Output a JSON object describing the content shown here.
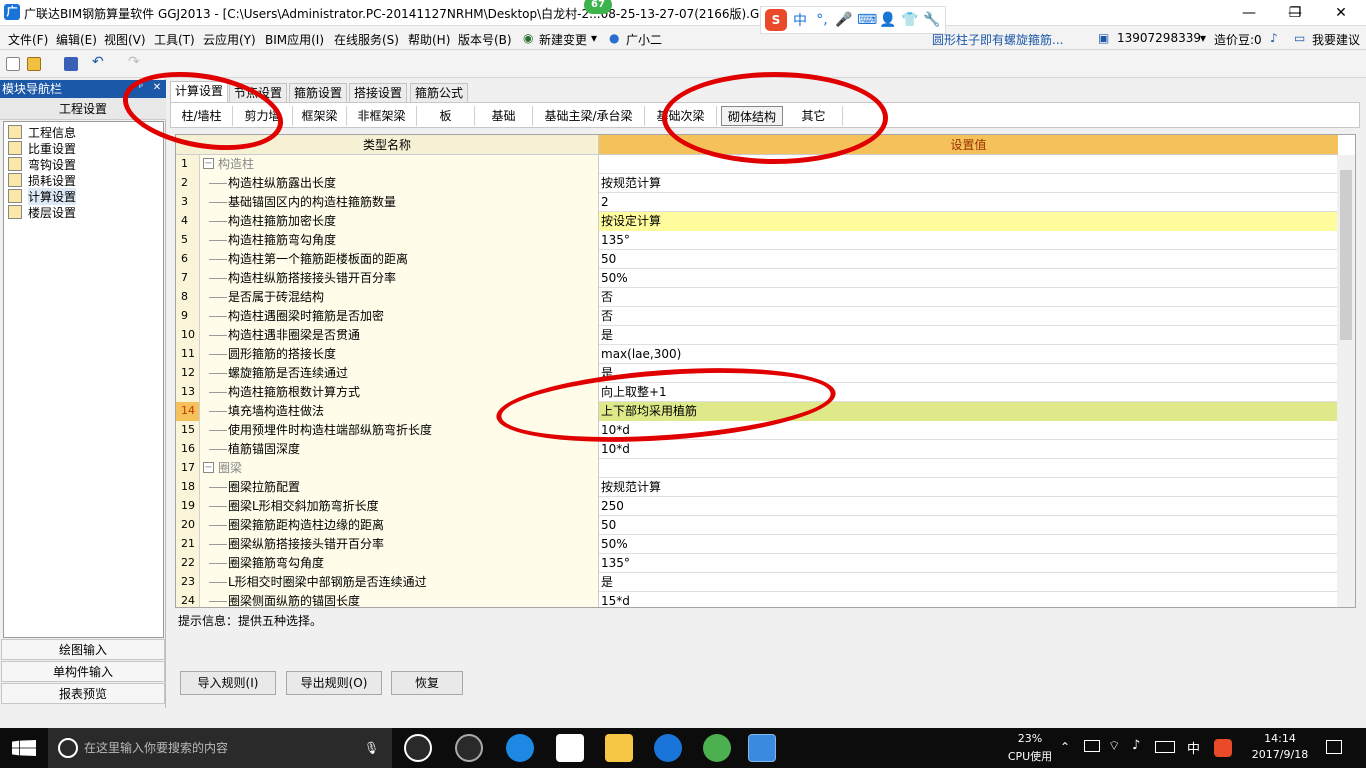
{
  "window": {
    "title": "广联达BIM钢筋算量软件 GGJ2013 - [C:\\Users\\Administrator.PC-20141127NRHM\\Desktop\\白龙村-2...08-25-13-27-07(2166版).GG...]",
    "badge": "67",
    "minimize": "—",
    "restore": "❐",
    "close": "✕"
  },
  "ime": {
    "logo": "S",
    "items": [
      "中",
      "°,",
      "🎤",
      "⌨",
      "👤",
      "👕",
      "🔧"
    ]
  },
  "menu": {
    "items": [
      "文件(F)",
      "编辑(E)",
      "视图(V)",
      "工具(T)",
      "云应用(Y)",
      "BIM应用(I)",
      "在线服务(S)",
      "帮助(H)",
      "版本号(B)",
      "新建变更",
      "广小二"
    ],
    "notice": "圆形柱子即有螺旋箍筋...",
    "phone": "13907298339",
    "beans": "造价豆:0",
    "suggest": "我要建议"
  },
  "nav": {
    "title": "模块导航栏",
    "pin": "ᵖ",
    "close": "✕",
    "section": "工程设置",
    "items": [
      "工程信息",
      "比重设置",
      "弯钩设置",
      "损耗设置",
      "计算设置",
      "楼层设置"
    ],
    "bottom": [
      "绘图输入",
      "单构件输入",
      "报表预览"
    ]
  },
  "tabs": [
    "计算设置",
    "节点设置",
    "箍筋设置",
    "搭接设置",
    "箍筋公式"
  ],
  "subtabs": [
    "柱/墙柱",
    "剪力墙",
    "框架梁",
    "非框架梁",
    "板",
    "基础",
    "基础主梁/承台梁",
    "基础次梁",
    "砌体结构",
    "其它"
  ],
  "grid": {
    "col_name": "类型名称",
    "col_value": "设置值",
    "rows": [
      {
        "no": "1",
        "name": "构造柱",
        "value": "",
        "group": true
      },
      {
        "no": "2",
        "name": "构造柱纵筋露出长度",
        "value": "按规范计算"
      },
      {
        "no": "3",
        "name": "基础锚固区内的构造柱箍筋数量",
        "value": "2"
      },
      {
        "no": "4",
        "name": "构造柱箍筋加密长度",
        "value": "按设定计算",
        "hl": true
      },
      {
        "no": "5",
        "name": "构造柱箍筋弯勾角度",
        "value": "135°"
      },
      {
        "no": "6",
        "name": "构造柱第一个箍筋距楼板面的距离",
        "value": "50"
      },
      {
        "no": "7",
        "name": "构造柱纵筋搭接接头错开百分率",
        "value": "50%"
      },
      {
        "no": "8",
        "name": "是否属于砖混结构",
        "value": "否"
      },
      {
        "no": "9",
        "name": "构造柱遇圈梁时箍筋是否加密",
        "value": "否"
      },
      {
        "no": "10",
        "name": "构造柱遇非圈梁是否贯通",
        "value": "是"
      },
      {
        "no": "11",
        "name": "圆形箍筋的搭接长度",
        "value": "max(lae,300)"
      },
      {
        "no": "12",
        "name": "螺旋箍筋是否连续通过",
        "value": "是"
      },
      {
        "no": "13",
        "name": "构造柱箍筋根数计算方式",
        "value": "向上取整+1"
      },
      {
        "no": "14",
        "name": "填充墙构造柱做法",
        "value": "上下部均采用植筋",
        "cur": true
      },
      {
        "no": "15",
        "name": "使用预埋件时构造柱端部纵筋弯折长度",
        "value": "10*d"
      },
      {
        "no": "16",
        "name": "植筋锚固深度",
        "value": "10*d"
      },
      {
        "no": "17",
        "name": "圈梁",
        "value": "",
        "group": true
      },
      {
        "no": "18",
        "name": "圈梁拉筋配置",
        "value": "按规范计算"
      },
      {
        "no": "19",
        "name": "圈梁L形相交斜加筋弯折长度",
        "value": "250"
      },
      {
        "no": "20",
        "name": "圈梁箍筋距构造柱边缘的距离",
        "value": "50"
      },
      {
        "no": "21",
        "name": "圈梁纵筋搭接接头错开百分率",
        "value": "50%"
      },
      {
        "no": "22",
        "name": "圈梁箍筋弯勾角度",
        "value": "135°"
      },
      {
        "no": "23",
        "name": "L形相交时圈梁中部钢筋是否连续通过",
        "value": "是"
      },
      {
        "no": "24",
        "name": "圈梁侧面纵筋的锚固长度",
        "value": "15*d"
      }
    ]
  },
  "hint": "提示信息：提供五种选择。",
  "buttons": {
    "import": "导入规则(I)",
    "export": "导出规则(O)",
    "restore": "恢复"
  },
  "taskbar": {
    "search_placeholder": "在这里输入你要搜索的内容",
    "cpu_percent": "23%",
    "cpu_label": "CPU使用",
    "lang": "中",
    "time": "14:14",
    "date": "2017/9/18"
  },
  "colors": {
    "annotation": "#e00000",
    "nav_title": "#1c58a8",
    "header_value": "#f5c15a",
    "highlight": "#fffc9d",
    "current": "#dfe98a"
  }
}
